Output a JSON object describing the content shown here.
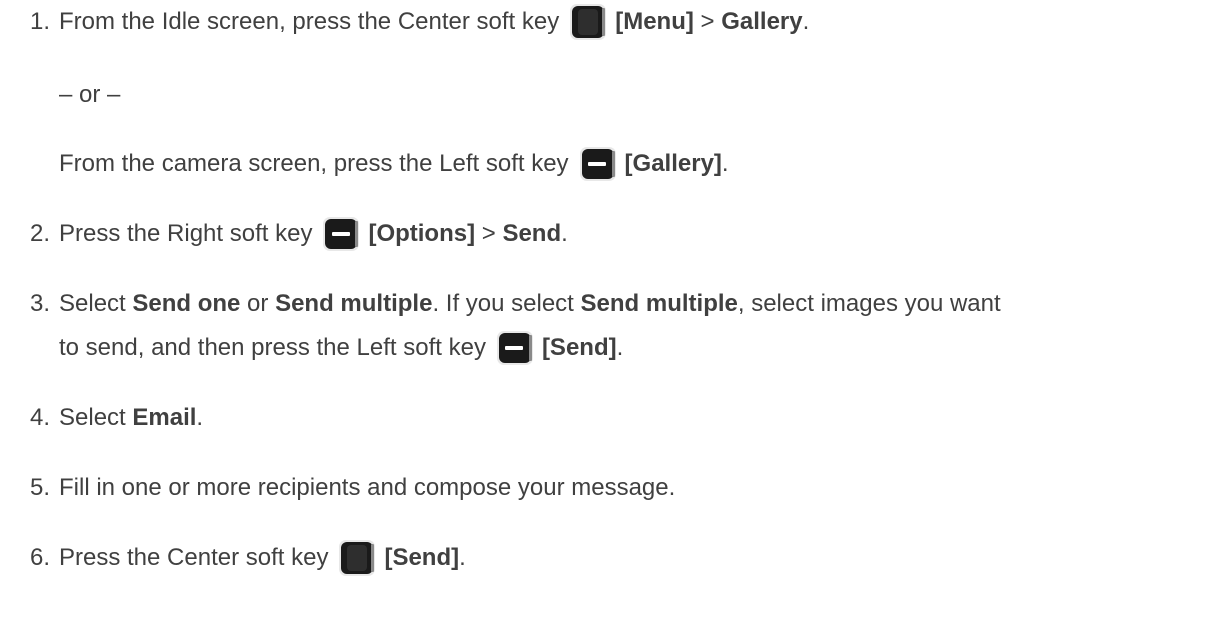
{
  "steps": [
    {
      "number": "1.",
      "before": "From the Idle screen, press the Center soft key",
      "key_icon": "center-soft-key",
      "key_label": "[Menu]",
      "sep": " > ",
      "target": "Gallery",
      "end": "."
    },
    {
      "or_text": "– or –"
    },
    {
      "before": "From the camera screen, press the Left soft key",
      "key_icon": "left-soft-key",
      "key_label": "[Gallery]",
      "end": "."
    },
    {
      "number": "2.",
      "before": "Press the Right soft key",
      "key_icon": "right-soft-key",
      "key_label": "[Options]",
      "sep": " > ",
      "target": "Send",
      "end": "."
    },
    {
      "number": "3.",
      "t1": "Select ",
      "b1": "Send one",
      "t2": " or ",
      "b2": "Send multiple",
      "t3": ". If you select ",
      "b3": "Send multiple",
      "t4": ", select images you want",
      "cont": "to send, and then press the Left soft key",
      "key_icon": "left-soft-key",
      "key_label": "[Send]",
      "end": "."
    },
    {
      "number": "4.",
      "before": "Select ",
      "target": "Email",
      "end": "."
    },
    {
      "number": "5.",
      "text": "Fill in one or more recipients and compose your message."
    },
    {
      "number": "6.",
      "before": "Press the Center soft key",
      "key_icon": "center-soft-key",
      "key_label": "[Send]",
      "end": "."
    }
  ]
}
